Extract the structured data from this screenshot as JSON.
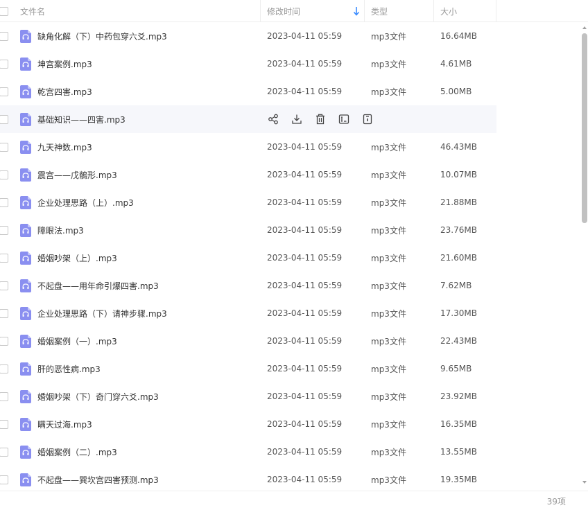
{
  "header": {
    "name_label": "文件名",
    "time_label": "修改时间",
    "type_label": "类型",
    "size_label": "大小"
  },
  "hover_actions": [
    "share-icon",
    "download-icon",
    "delete-icon",
    "rename-icon",
    "more-icon"
  ],
  "colors": {
    "file_icon": "#8a8ff0",
    "sort_arrow": "#3b8cff",
    "hover_row": "#f6f7fb"
  },
  "files": [
    {
      "name": "缺角化解（下）中药包穿六爻.mp3",
      "time": "2023-04-11 05:59",
      "type": "mp3文件",
      "size": "16.64MB"
    },
    {
      "name": "坤宫案例.mp3",
      "time": "2023-04-11 05:59",
      "type": "mp3文件",
      "size": "4.61MB"
    },
    {
      "name": "乾宫四害.mp3",
      "time": "2023-04-11 05:59",
      "type": "mp3文件",
      "size": "5.00MB"
    },
    {
      "name": "基础知识——四害.mp3",
      "time": "",
      "type": "",
      "size": ""
    },
    {
      "name": "九天神数.mp3",
      "time": "2023-04-11 05:59",
      "type": "mp3文件",
      "size": "46.43MB"
    },
    {
      "name": "震宫——戊鶺形.mp3",
      "time": "2023-04-11 05:59",
      "type": "mp3文件",
      "size": "10.07MB"
    },
    {
      "name": "企业处理思路（上）.mp3",
      "time": "2023-04-11 05:59",
      "type": "mp3文件",
      "size": "21.88MB"
    },
    {
      "name": "障眼法.mp3",
      "time": "2023-04-11 05:59",
      "type": "mp3文件",
      "size": "23.76MB"
    },
    {
      "name": "婚姻吵架（上）.mp3",
      "time": "2023-04-11 05:59",
      "type": "mp3文件",
      "size": "21.60MB"
    },
    {
      "name": "不起盘——用年命引爆四害.mp3",
      "time": "2023-04-11 05:59",
      "type": "mp3文件",
      "size": "7.62MB"
    },
    {
      "name": "企业处理思路（下）请神步骤.mp3",
      "time": "2023-04-11 05:59",
      "type": "mp3文件",
      "size": "17.30MB"
    },
    {
      "name": "婚姻案例（一）.mp3",
      "time": "2023-04-11 05:59",
      "type": "mp3文件",
      "size": "22.43MB"
    },
    {
      "name": "肝的恶性病.mp3",
      "time": "2023-04-11 05:59",
      "type": "mp3文件",
      "size": "9.65MB"
    },
    {
      "name": "婚姻吵架（下）奇门穿六爻.mp3",
      "time": "2023-04-11 05:59",
      "type": "mp3文件",
      "size": "23.92MB"
    },
    {
      "name": "瞒天过海.mp3",
      "time": "2023-04-11 05:59",
      "type": "mp3文件",
      "size": "16.35MB"
    },
    {
      "name": "婚姻案例（二）.mp3",
      "time": "2023-04-11 05:59",
      "type": "mp3文件",
      "size": "13.55MB"
    },
    {
      "name": "不起盘——巽坎宫四害预测.mp3",
      "time": "2023-04-11 05:59",
      "type": "mp3文件",
      "size": "19.35MB"
    }
  ],
  "footer": {
    "count": "39项"
  }
}
